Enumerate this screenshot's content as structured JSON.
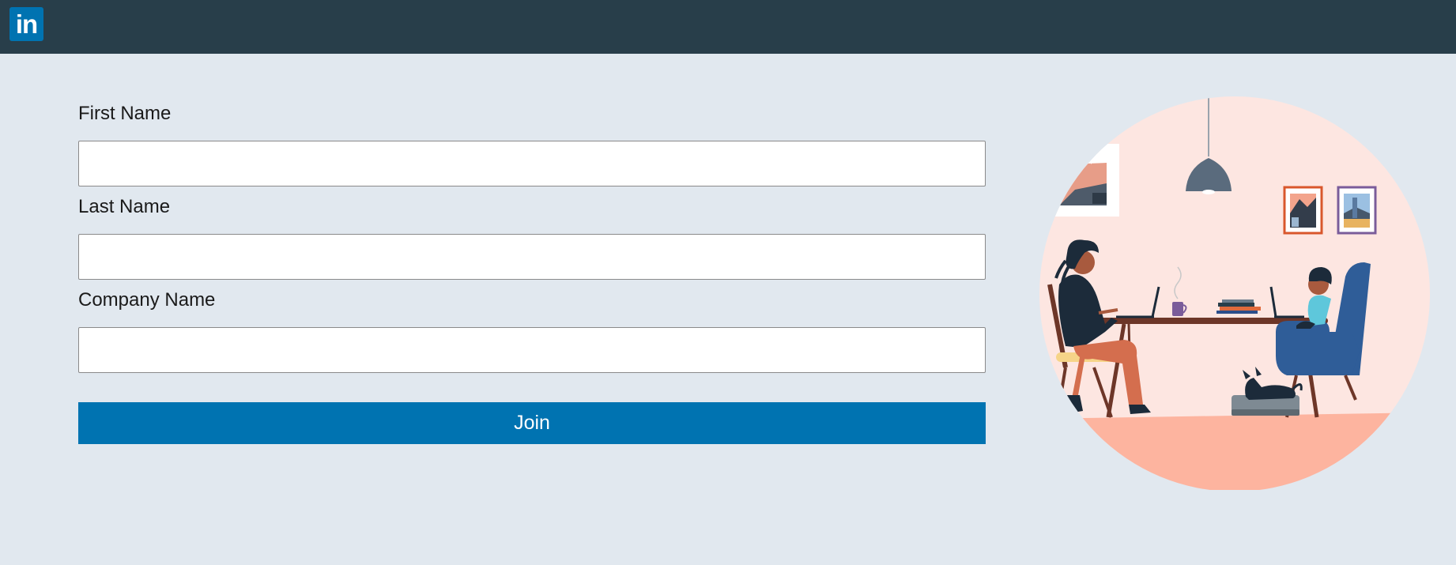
{
  "header": {
    "logo_text": "in",
    "logo_color": "#0073b1",
    "bar_color": "#283e4a"
  },
  "form": {
    "fields": [
      {
        "label": "First Name",
        "value": "",
        "placeholder": ""
      },
      {
        "label": "Last Name",
        "value": "",
        "placeholder": ""
      },
      {
        "label": "Company Name",
        "value": "",
        "placeholder": ""
      }
    ],
    "submit_label": "Join",
    "accent_color": "#0073b1"
  },
  "illustration": {
    "icon": "people-working-at-table-illustration"
  }
}
